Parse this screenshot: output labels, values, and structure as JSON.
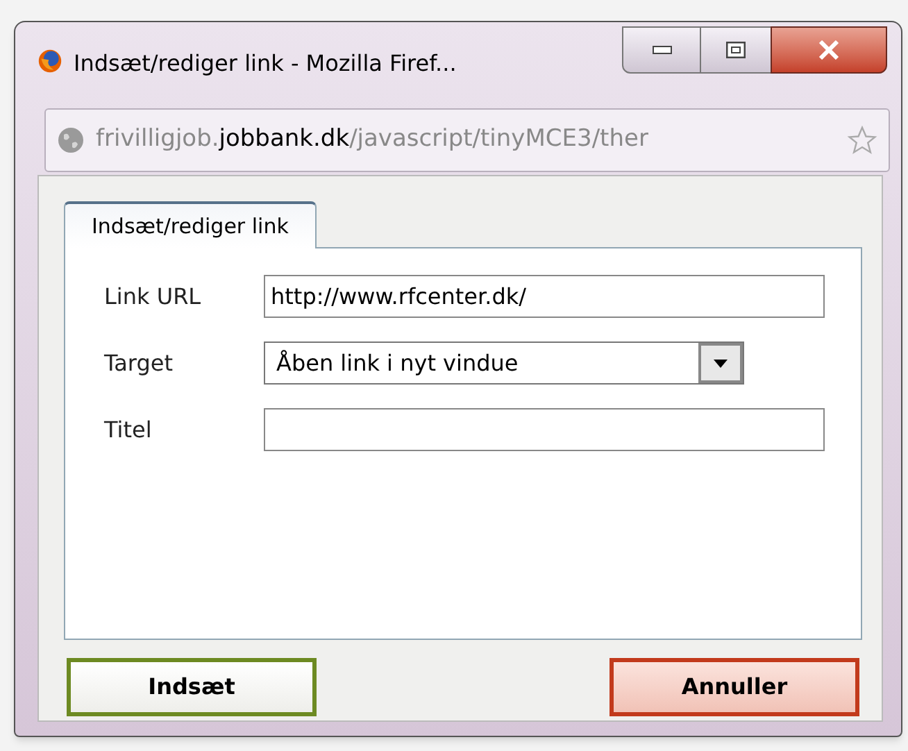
{
  "window": {
    "title": "Indsæt/rediger link - Mozilla Firef..."
  },
  "address_bar": {
    "url_parts": [
      {
        "text": "frivilligjob.",
        "kind": "muted"
      },
      {
        "text": "jobbank.dk",
        "kind": "domain"
      },
      {
        "text": "/javascript/tinyMCE3/ther",
        "kind": "muted"
      }
    ]
  },
  "tabs": [
    {
      "label": "Indsæt/rediger link",
      "selected": true
    }
  ],
  "fields": [
    {
      "label": "Link URL",
      "kind": "text",
      "value": "http://www.rfcenter.dk/"
    },
    {
      "label": "Target",
      "kind": "select",
      "value": "Åben link i nyt vindue"
    },
    {
      "label": "Titel",
      "kind": "text"
    }
  ],
  "buttons": [
    {
      "label": "Indsæt",
      "kind": "confirm"
    },
    {
      "label": "Annuller",
      "kind": "cancel"
    }
  ]
}
